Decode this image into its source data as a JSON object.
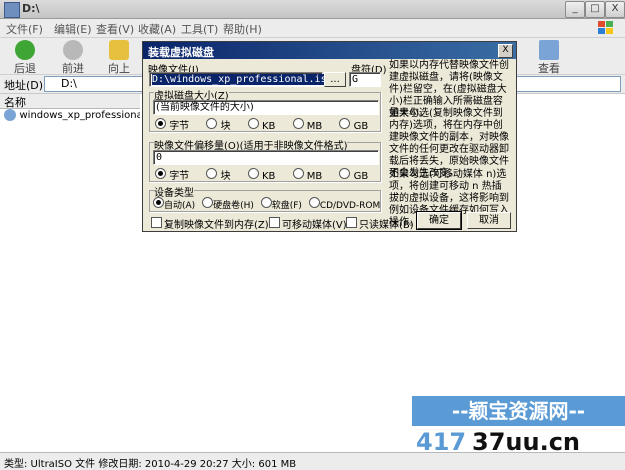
{
  "window": {
    "title": "D:\\",
    "controls": {
      "minimize": "_",
      "maximize": "□",
      "close": "X"
    }
  },
  "menu": [
    "文件(F)",
    "编辑(E)",
    "查看(V)",
    "收藏(A)",
    "工具(T)",
    "帮助(H)"
  ],
  "toolbar": {
    "back": "后退",
    "forward": "前进",
    "up": "向上",
    "view": "查看"
  },
  "address": {
    "label": "地址(D)",
    "value": "D:\\"
  },
  "filelist": {
    "header": "名称",
    "items": [
      "windows_xp_professional.iso"
    ]
  },
  "status": {
    "text": "类型: UltraISO 文件 修改日期: 2010-4-29 20:27 大小: 601 MB"
  },
  "dialog": {
    "title": "装载虚拟磁盘",
    "image_file_label": "映像文件(I)",
    "image_file_value": "D:\\windows_xp_professional.iso",
    "browse": "...",
    "drive_label": "盘符(D)",
    "drive_value": "G",
    "size_group": "虚拟磁盘大小(Z)",
    "size_value": "(当前映像文件的大小)",
    "units": [
      "字节",
      "块",
      "KB",
      "MB",
      "GB"
    ],
    "offset_group": "映像文件偏移量(O)(适用于非映像文件格式)",
    "offset_value": "0",
    "device_group": "设备类型",
    "device_types": [
      "自动(A)",
      "硬盘卷(H)",
      "软盘(F)",
      "CD/DVD-ROM"
    ],
    "copy_to_memory": "复制映像文件到内存(Z)",
    "removable": "可移动媒体(V)",
    "readonly": "只读媒体(B)",
    "ok": "确定",
    "cancel": "取消",
    "help1": "如果以内存代替映像文件创建虚拟磁盘，请将(映像文件)栏留空，在(虚拟磁盘大小)栏正确输入所需磁盘容量大小。",
    "help2": "如果勾选(复制映像文件到内存)选项，将在内存中创建映像文件的副本，对映像文件的任何更改在驱动器卸载后将丢失，原始映像文件不会发生改变。",
    "help3": "如果勾选(可移动媒体 n)选项，将创建可移动 n 热插拔的虚拟设备，这将影响到例如设备文件缓存如何写入操作。"
  },
  "watermark": {
    "line1": "--颖宝资源网--",
    "line2a": "417",
    "line2b": "37uu.cn"
  }
}
